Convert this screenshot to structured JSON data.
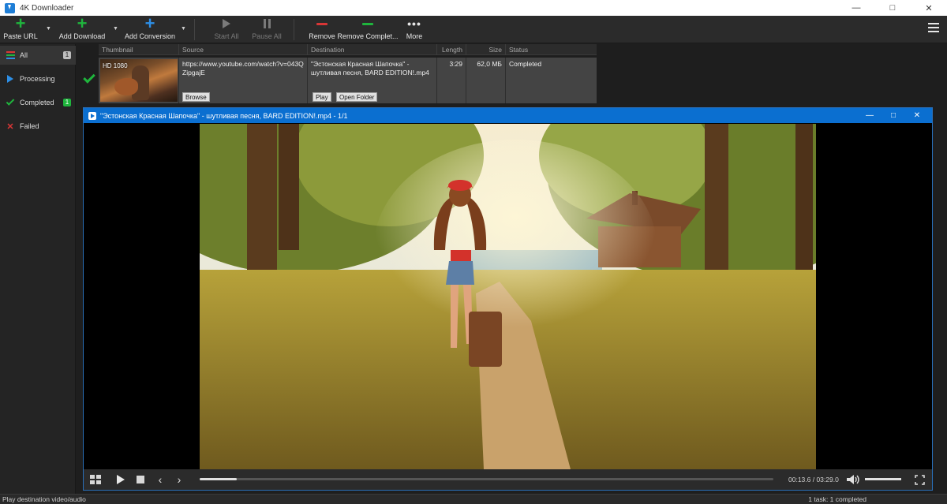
{
  "window": {
    "title": "4K Downloader"
  },
  "toolbar": {
    "paste_url": "Paste URL",
    "add_download": "Add Download",
    "add_conversion": "Add Conversion",
    "start_all": "Start All",
    "pause_all": "Pause All",
    "remove": "Remove",
    "remove_completed": "Remove Complet...",
    "more": "More"
  },
  "sidebar": {
    "items": [
      {
        "label": "All",
        "count": "1"
      },
      {
        "label": "Processing"
      },
      {
        "label": "Completed",
        "count": "1"
      },
      {
        "label": "Failed"
      }
    ]
  },
  "table": {
    "headers": {
      "thumbnail": "Thumbnail",
      "source": "Source",
      "destination": "Destination",
      "length": "Length",
      "size": "Size",
      "status": "Status"
    },
    "rows": [
      {
        "quality": "HD 1080",
        "source": "https://www.youtube.com/watch?v=043QZipgajE",
        "destination": "\"Эстонская Красная Шапочка\" - шутливая песня, BARD EDITION!.mp4",
        "length": "3:29",
        "size": "62,0 МБ",
        "status": "Completed",
        "browse_label": "Browse",
        "play_label": "Play",
        "open_folder_label": "Open Folder"
      }
    ]
  },
  "player": {
    "title": "\"Эстонская Красная Шапочка\" - шутливая песня, BARD EDITION!.mp4 - 1/1",
    "time": "00:13.6 / 03:29.0",
    "progress": 0.065,
    "volume": 1.0
  },
  "statusbar": {
    "left": "Play destination video/audio",
    "right": "1 task: 1 completed"
  },
  "colors": {
    "accent_blue": "#0b6fd0",
    "green": "#1fb53d",
    "red": "#d93636"
  }
}
